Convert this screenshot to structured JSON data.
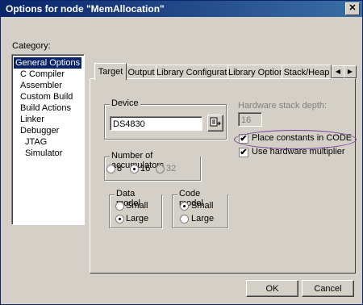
{
  "window": {
    "title": "Options for node \"MemAllocation\"",
    "close_glyph": "✕"
  },
  "category": {
    "label": "Category:",
    "items": [
      "General Options",
      "C Compiler",
      "Assembler",
      "Custom Build",
      "Build Actions",
      "Linker",
      "Debugger",
      "JTAG",
      "Simulator"
    ],
    "selected": "General Options"
  },
  "tabs": {
    "items": [
      "Target",
      "Output",
      "Library Configuration",
      "Library Options",
      "Stack/Heap"
    ],
    "active": "Target",
    "scroll_left": "◀",
    "scroll_right": "▶"
  },
  "device": {
    "label": "Device",
    "value": "DS4830",
    "browse_icon": "device-browse-icon"
  },
  "hw_stack": {
    "label": "Hardware stack depth:",
    "value": "16"
  },
  "options": {
    "place_constants": {
      "label": "Place constants in CODE",
      "checked": "✔"
    },
    "hw_multiplier": {
      "label": "Use hardware multiplier",
      "checked": "✔"
    }
  },
  "accumulators": {
    "label": "Number of accumulators",
    "opt1": "8",
    "opt2": "16",
    "opt3": "32",
    "selected": "16"
  },
  "data_model": {
    "label": "Data model",
    "opt1": "Small",
    "opt2": "Large",
    "selected": "Large"
  },
  "code_model": {
    "label": "Code model",
    "opt1": "Small",
    "opt2": "Large",
    "selected": "Small"
  },
  "buttons": {
    "ok": "OK",
    "cancel": "Cancel"
  },
  "colors": {
    "title_start": "#0a246a",
    "title_end": "#3a6ea5",
    "face": "#d4d0c8",
    "highlight_ellipse": "#7a3d9a"
  }
}
